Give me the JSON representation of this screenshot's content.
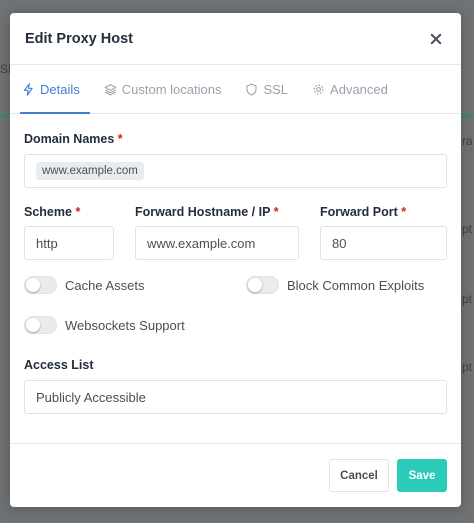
{
  "background": {
    "fragments": [
      "SI",
      "ra",
      "pt",
      "pt",
      "pt"
    ]
  },
  "modal": {
    "title": "Edit Proxy Host"
  },
  "tabs": [
    {
      "label": "Details",
      "icon": "bolt-icon",
      "active": true
    },
    {
      "label": "Custom locations",
      "icon": "layers-icon",
      "active": false
    },
    {
      "label": "SSL",
      "icon": "shield-icon",
      "active": false
    },
    {
      "label": "Advanced",
      "icon": "gear-icon",
      "active": false
    }
  ],
  "form": {
    "domain_names": {
      "label": "Domain Names",
      "required": "*",
      "chips": [
        "www.example.com"
      ]
    },
    "scheme": {
      "label": "Scheme",
      "required": "*",
      "value": "http"
    },
    "forward_hostname": {
      "label": "Forward Hostname / IP",
      "required": "*",
      "value": "www.example.com"
    },
    "forward_port": {
      "label": "Forward Port",
      "required": "*",
      "value": "80"
    },
    "toggles": {
      "cache_assets": {
        "label": "Cache Assets",
        "on": false
      },
      "block_exploits": {
        "label": "Block Common Exploits",
        "on": false
      },
      "websockets": {
        "label": "Websockets Support",
        "on": false
      }
    },
    "access_list": {
      "label": "Access List",
      "value": "Publicly Accessible"
    }
  },
  "footer": {
    "cancel_label": "Cancel",
    "save_label": "Save"
  },
  "colors": {
    "accent": "#467fcf",
    "save": "#2bcbba",
    "required": "#cd201f"
  }
}
